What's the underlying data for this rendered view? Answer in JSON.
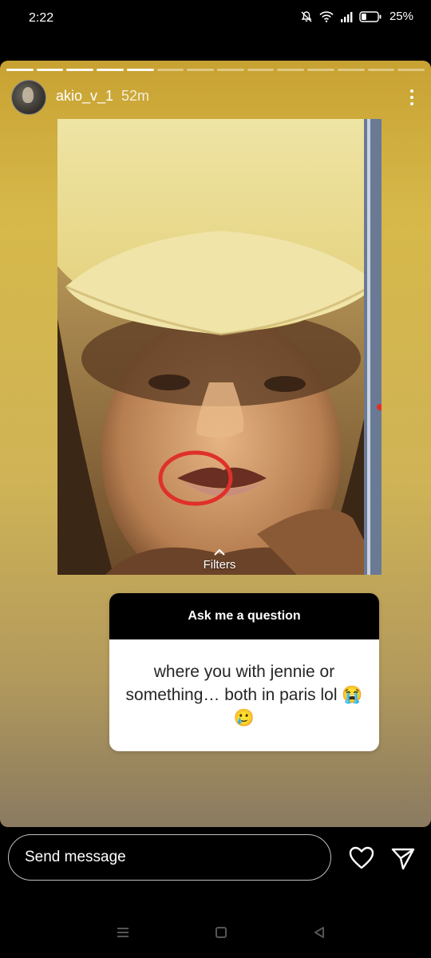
{
  "status_bar": {
    "time": "2:22",
    "battery": "25%"
  },
  "story": {
    "segments_total": 14,
    "segments_viewed": 5,
    "username": "akio_v_1",
    "time_ago": "52m",
    "filters_label": "Filters"
  },
  "question_sticker": {
    "header": "Ask me a question",
    "answer": "where you with jennie or something… both in paris lol 😭🥲"
  },
  "bottom_bar": {
    "message_placeholder": "Send message"
  },
  "colors": {
    "story_background": "#d6b84a",
    "highlight_circle": "#e0302a",
    "sticker_header": "#000000"
  }
}
